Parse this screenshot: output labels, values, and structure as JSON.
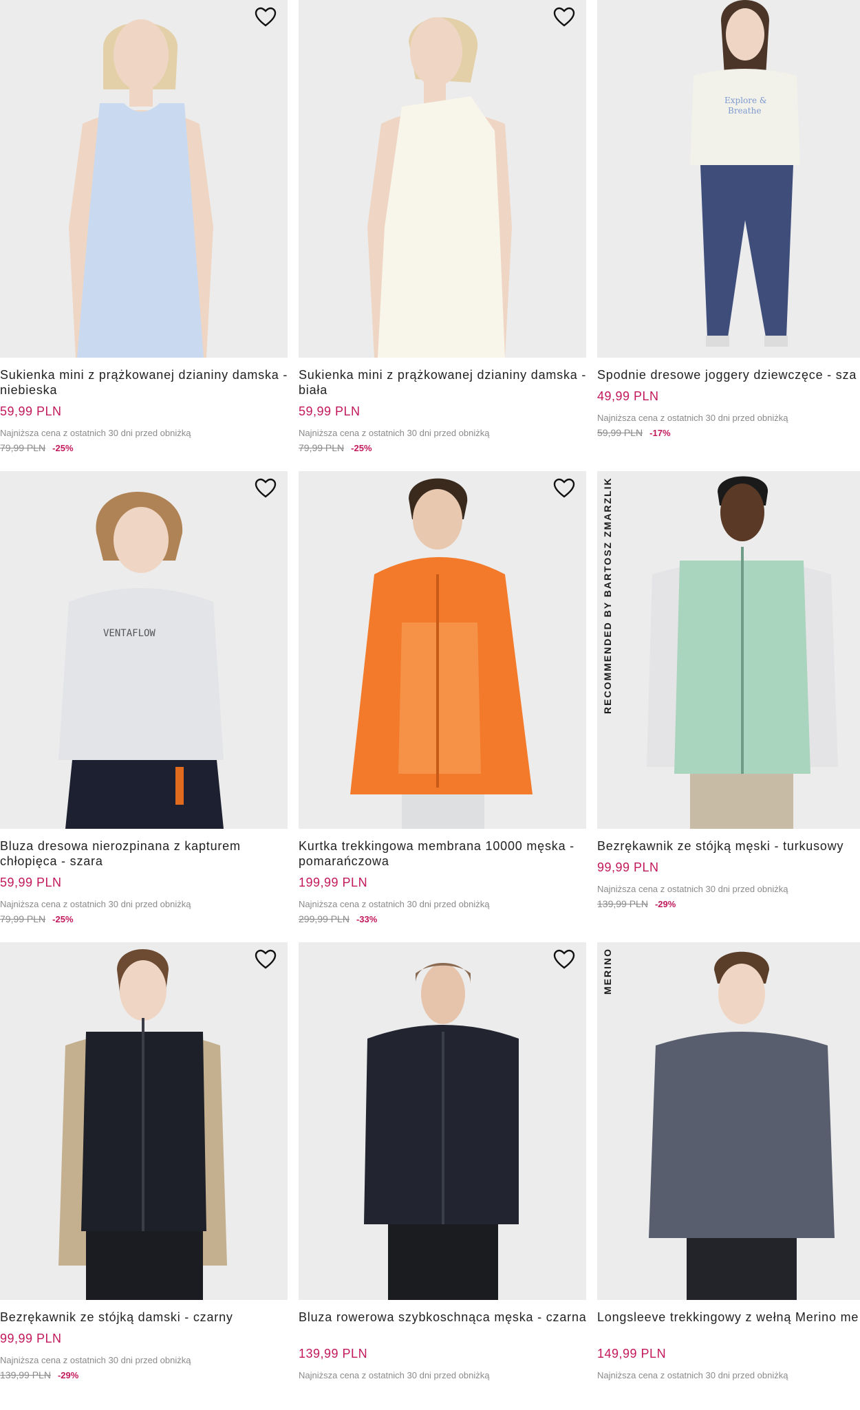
{
  "wishlist_icon": "heart-outline-icon",
  "products": [
    {
      "name": "Sukienka mini z prążkowanej dzianiny damska - niebieska",
      "price": "59,99 PLN",
      "lowest_note": "Najniższa cena z ostatnich 30 dni przed obniżką",
      "old_price": "79,99 PLN",
      "discount": "-25%",
      "badge": ""
    },
    {
      "name": "Sukienka mini z prążkowanej dzianiny damska - biała",
      "price": "59,99 PLN",
      "lowest_note": "Najniższa cena z ostatnich 30 dni przed obniżką",
      "old_price": "79,99 PLN",
      "discount": "-25%",
      "badge": ""
    },
    {
      "name": "Spodnie dresowe joggery dziewczęce - sza",
      "price": "49,99 PLN",
      "lowest_note": "Najniższa cena z ostatnich 30 dni przed obniżką",
      "old_price": "59,99 PLN",
      "discount": "-17%",
      "badge": ""
    },
    {
      "name": "Bluza dresowa nierozpinana z kapturem chłopięca - szara",
      "price": "59,99 PLN",
      "lowest_note": "Najniższa cena z ostatnich 30 dni przed obniżką",
      "old_price": "79,99 PLN",
      "discount": "-25%",
      "badge": ""
    },
    {
      "name": "Kurtka trekkingowa membrana 10000 męska - pomarańczowa",
      "price": "199,99 PLN",
      "lowest_note": "Najniższa cena z ostatnich 30 dni przed obniżką",
      "old_price": "299,99 PLN",
      "discount": "-33%",
      "badge": ""
    },
    {
      "name": "Bezrękawnik ze stójką męski - turkusowy",
      "price": "99,99 PLN",
      "lowest_note": "Najniższa cena z ostatnich 30 dni przed obniżką",
      "old_price": "139,99 PLN",
      "discount": "-29%",
      "badge": "RECOMMENDED BY BARTOSZ ZMARZLIK"
    },
    {
      "name": "Bezrękawnik ze stójką damski - czarny",
      "price": "99,99 PLN",
      "lowest_note": "Najniższa cena z ostatnich 30 dni przed obniżką",
      "old_price": "139,99 PLN",
      "discount": "-29%",
      "badge": ""
    },
    {
      "name": "Bluza rowerowa szybkoschnąca męska - czarna",
      "price": "139,99 PLN",
      "lowest_note": "Najniższa cena z ostatnich 30 dni przed obniżką",
      "old_price": "",
      "discount": "",
      "badge": ""
    },
    {
      "name": "Longsleeve trekkingowy z wełną Merino me - szary",
      "price": "149,99 PLN",
      "lowest_note": "Najniższa cena z ostatnich 30 dni przed obniżką",
      "old_price": "",
      "discount": "",
      "badge": "MERINO"
    }
  ]
}
